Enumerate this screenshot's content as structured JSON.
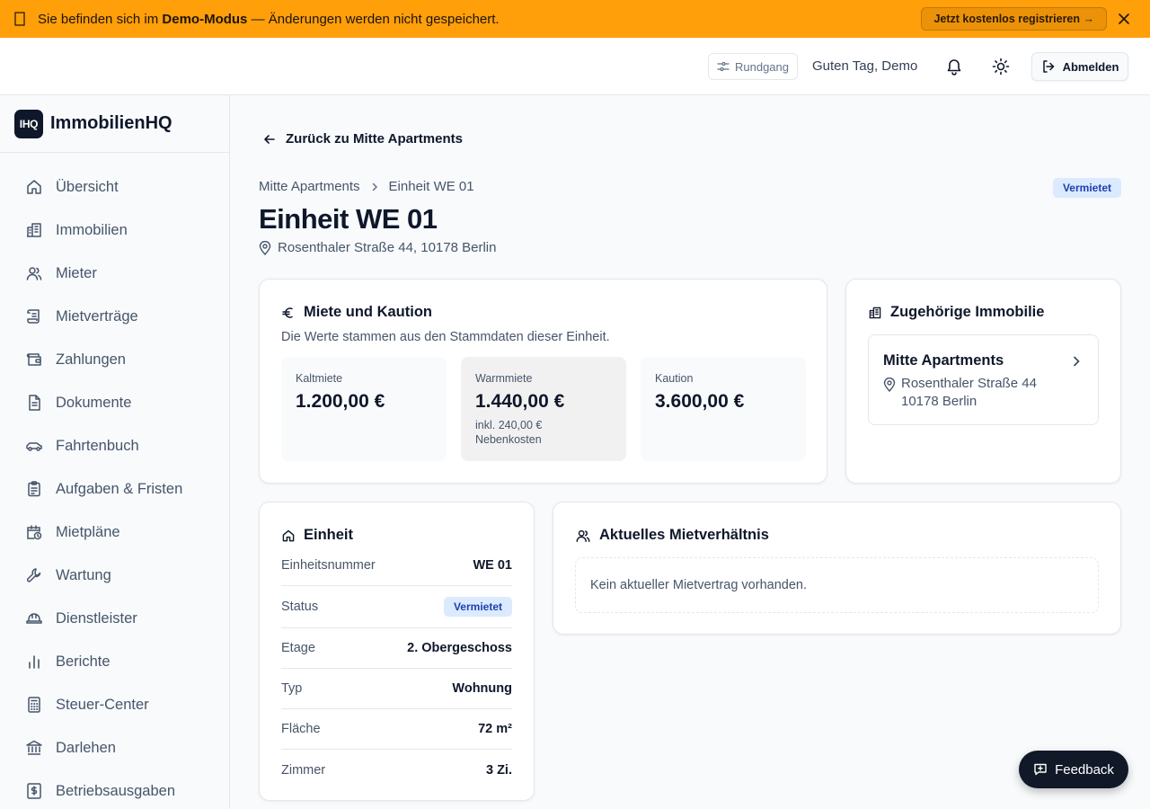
{
  "banner": {
    "prefix": "Sie befinden sich im ",
    "mode": "Demo-Modus",
    "suffix": " — Änderungen werden nicht gespeichert.",
    "register_label": "Jetzt kostenlos registrieren →",
    "background": "#ff9f0a"
  },
  "header": {
    "tour_label": "Rundgang",
    "greeting": "Guten Tag, Demo",
    "logout_label": "Abmelden"
  },
  "sidebar": {
    "logo_text": "IHQ",
    "brand": "ImmobilienHQ",
    "items": [
      {
        "label": "Übersicht",
        "icon": "home-icon"
      },
      {
        "label": "Immobilien",
        "icon": "building-icon"
      },
      {
        "label": "Mieter",
        "icon": "users-icon"
      },
      {
        "label": "Mietverträge",
        "icon": "scroll-icon"
      },
      {
        "label": "Zahlungen",
        "icon": "wallet-icon"
      },
      {
        "label": "Dokumente",
        "icon": "document-icon"
      },
      {
        "label": "Fahrtenbuch",
        "icon": "car-icon"
      },
      {
        "label": "Aufgaben & Fristen",
        "icon": "clipboard-icon"
      },
      {
        "label": "Mietpläne",
        "icon": "calendar-clock-icon"
      },
      {
        "label": "Wartung",
        "icon": "wrench-icon"
      },
      {
        "label": "Dienstleister",
        "icon": "hard-hat-icon"
      },
      {
        "label": "Berichte",
        "icon": "bar-chart-icon"
      },
      {
        "label": "Steuer-Center",
        "icon": "calculator-icon"
      },
      {
        "label": "Darlehen",
        "icon": "bank-icon"
      },
      {
        "label": "Betriebsausgaben",
        "icon": "receipt-icon"
      }
    ]
  },
  "main": {
    "back_label": "Zurück zu Mitte Apartments",
    "breadcrumb": [
      "Mitte Apartments",
      "Einheit WE 01"
    ],
    "status": "Vermietet",
    "title": "Einheit WE 01",
    "address": "Rosenthaler Straße 44, 10178 Berlin"
  },
  "rent_card": {
    "title": "Miete und Kaution",
    "subtitle": "Die Werte stammen aus den Stammdaten dieser Einheit.",
    "tiles": [
      {
        "label": "Kaltmiete",
        "value": "1.200,00 €"
      },
      {
        "label": "Warmmiete",
        "value": "1.440,00 €",
        "note": "inkl. 240,00 € Nebenkosten"
      },
      {
        "label": "Kaution",
        "value": "3.600,00 €"
      }
    ]
  },
  "property_card": {
    "title": "Zugehörige Immobilie",
    "name": "Mitte Apartments",
    "street": "Rosenthaler Straße 44",
    "city": "10178 Berlin"
  },
  "unit_card": {
    "title": "Einheit",
    "rows": [
      {
        "key": "Einheitsnummer",
        "value": "WE 01"
      },
      {
        "key": "Status",
        "value": "Vermietet"
      },
      {
        "key": "Etage",
        "value": "2. Obergeschoss"
      },
      {
        "key": "Typ",
        "value": "Wohnung"
      },
      {
        "key": "Fläche",
        "value": "72 m²"
      },
      {
        "key": "Zimmer",
        "value": "3 Zi."
      }
    ]
  },
  "tenancy_card": {
    "title": "Aktuelles Mietverhältnis",
    "empty_text": "Kein aktueller Mietvertrag vorhanden."
  },
  "feedback_label": "Feedback"
}
